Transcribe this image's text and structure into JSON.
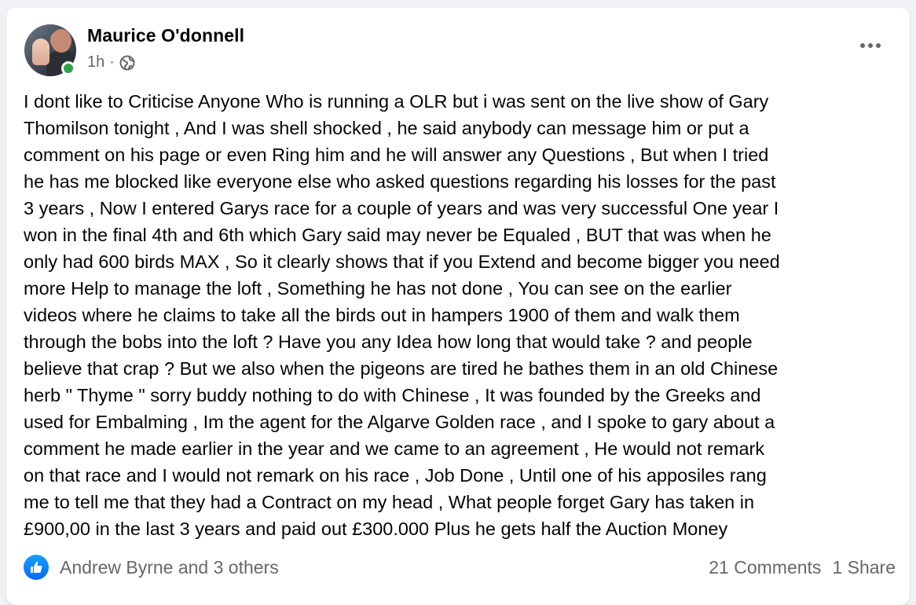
{
  "post": {
    "author": "Maurice O'donnell",
    "time": "1h",
    "separator": "·",
    "privacy_icon": "globe-icon",
    "more_icon": "more-options-icon",
    "text_lines": [
      "I dont like to Criticise Anyone Who is running a OLR but i was sent on the live show of Gary",
      "Thomilson tonight , And I was shell shocked ,  he said anybody can message him or put a",
      "comment on his page or even Ring him and he will answer any Questions , But when I tried",
      "he has me blocked like everyone else who asked questions regarding his losses for the past",
      "3 years , Now I entered Garys race for a couple of years and was very successful One year I",
      "won in the final 4th and 6th which Gary said may never be Equaled , BUT that was when he",
      "only had 600 birds MAX , So it clearly shows that if you Extend and become bigger you need",
      "more Help to manage the loft , Something he has not done , You can see on the earlier",
      "videos where he claims to take all the birds out in hampers 1900 of them and walk them",
      "through the bobs into the loft ? Have you any Idea how long that would take ? and people",
      "believe that crap ? But we also when the pigeons are tired he bathes them in an old Chinese",
      "herb \" Thyme \" sorry buddy nothing to do with Chinese , It was founded by the Greeks and",
      "used for Embalming , Im the agent for the Algarve Golden race , and I spoke to gary about a",
      "comment he made earlier in the year and we came to an agreement , He would  not remark",
      "on that race and I would not remark on his race , Job Done , Until one of his apposiles rang",
      "me to tell me that they had a Contract on my head , What people forget Gary has taken in",
      "£900,00 in the last 3 years and paid out £300.000 Plus he gets half the Auction Money"
    ]
  },
  "footer": {
    "reaction_icon": "like-icon",
    "reactions_text": "Andrew Byrne and 3 others",
    "comments": "21 Comments",
    "shares": "1 Share"
  },
  "colors": {
    "online": "#31a24c",
    "like_blue": "#0866ff",
    "secondary_text": "#65676b"
  }
}
